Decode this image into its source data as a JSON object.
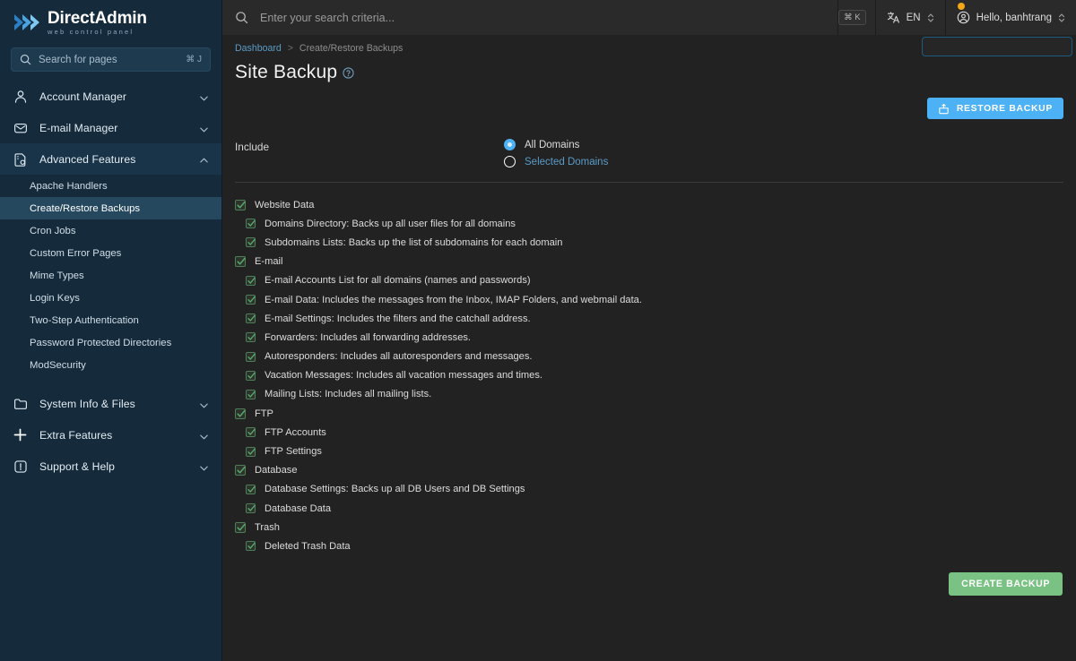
{
  "brand": {
    "title_part1": "Direct",
    "title_part2": "Admin",
    "subtitle": "web control panel",
    "logo_icon": "double-chevron-icon",
    "accent": "#4db1f5"
  },
  "sidebar": {
    "search": {
      "placeholder": "Search for pages",
      "shortcut": "⌘ J",
      "icon": "search-icon"
    },
    "groups": [
      {
        "label": "Account Manager",
        "icon": "user-icon",
        "expanded": false
      },
      {
        "label": "E-mail Manager",
        "icon": "envelope-icon",
        "expanded": false
      },
      {
        "label": "Advanced Features",
        "icon": "document-gear-icon",
        "expanded": true,
        "items": [
          {
            "label": "Apache Handlers",
            "active": false
          },
          {
            "label": "Create/Restore Backups",
            "active": true
          },
          {
            "label": "Cron Jobs",
            "active": false
          },
          {
            "label": "Custom Error Pages",
            "active": false
          },
          {
            "label": "Mime Types",
            "active": false
          },
          {
            "label": "Login Keys",
            "active": false
          },
          {
            "label": "Two-Step Authentication",
            "active": false
          },
          {
            "label": "Password Protected Directories",
            "active": false
          },
          {
            "label": "ModSecurity",
            "active": false
          }
        ]
      },
      {
        "label": "System Info & Files",
        "icon": "folder-icon",
        "expanded": false
      },
      {
        "label": "Extra Features",
        "icon": "plus-icon",
        "expanded": false
      },
      {
        "label": "Support & Help",
        "icon": "alert-icon",
        "expanded": false
      }
    ]
  },
  "topbar": {
    "search_placeholder": "Enter your search criteria...",
    "search_icon": "search-icon",
    "search_shortcut": "⌘ K",
    "language": {
      "label": "EN",
      "icon": "translate-icon"
    },
    "user": {
      "label": "Hello, banhtrang",
      "icon": "user-circle-icon"
    },
    "notification_color": "#f0a818"
  },
  "breadcrumb": {
    "root": "Dashboard",
    "separator": ">",
    "current": "Create/Restore Backups"
  },
  "page": {
    "title": "Site Backup",
    "help_icon": "question-circle-icon"
  },
  "actions": {
    "restore_label": "RESTORE BACKUP",
    "restore_icon": "restore-icon",
    "restore_color": "#4db1f5",
    "create_label": "CREATE BACKUP",
    "create_color": "#79c283"
  },
  "include": {
    "label": "Include",
    "options": [
      {
        "label": "All Domains",
        "selected": true
      },
      {
        "label": "Selected Domains",
        "selected": false
      }
    ]
  },
  "backup_items": [
    {
      "level": 0,
      "label": "Website Data",
      "checked": true
    },
    {
      "level": 1,
      "label": "Domains Directory: Backs up all user files for all domains",
      "checked": true
    },
    {
      "level": 1,
      "label": "Subdomains Lists: Backs up the list of subdomains for each domain",
      "checked": true
    },
    {
      "level": 0,
      "label": "E-mail",
      "checked": true
    },
    {
      "level": 1,
      "label": "E-mail Accounts List for all domains (names and passwords)",
      "checked": true
    },
    {
      "level": 1,
      "label": "E-mail Data: Includes the messages from the Inbox, IMAP Folders, and webmail data.",
      "checked": true
    },
    {
      "level": 1,
      "label": "E-mail Settings: Includes the filters and the catchall address.",
      "checked": true
    },
    {
      "level": 1,
      "label": "Forwarders: Includes all forwarding addresses.",
      "checked": true
    },
    {
      "level": 1,
      "label": "Autoresponders: Includes all autoresponders and messages.",
      "checked": true
    },
    {
      "level": 1,
      "label": "Vacation Messages: Includes all vacation messages and times.",
      "checked": true
    },
    {
      "level": 1,
      "label": "Mailing Lists: Includes all mailing lists.",
      "checked": true
    },
    {
      "level": 0,
      "label": "FTP",
      "checked": true
    },
    {
      "level": 1,
      "label": "FTP Accounts",
      "checked": true
    },
    {
      "level": 1,
      "label": "FTP Settings",
      "checked": true
    },
    {
      "level": 0,
      "label": "Database",
      "checked": true
    },
    {
      "level": 1,
      "label": "Database Settings: Backs up all DB Users and DB Settings",
      "checked": true
    },
    {
      "level": 1,
      "label": "Database Data",
      "checked": true
    },
    {
      "level": 0,
      "label": "Trash",
      "checked": true
    },
    {
      "level": 1,
      "label": "Deleted Trash Data",
      "checked": true
    }
  ]
}
